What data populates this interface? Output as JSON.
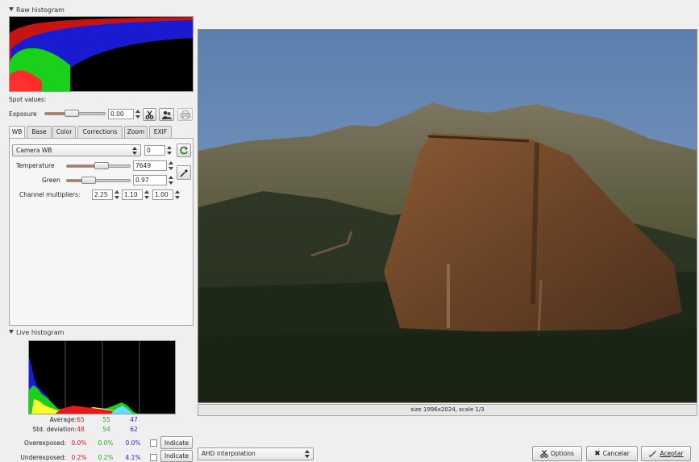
{
  "raw_histogram": {
    "title": "Raw histogram"
  },
  "spot_values": {
    "label": "Spot values:"
  },
  "exposure": {
    "label": "Exposure",
    "value": "0.00",
    "level": 0.45
  },
  "tabs": [
    {
      "label": "WB",
      "active": true
    },
    {
      "label": "Base"
    },
    {
      "label": "Color"
    },
    {
      "label": "Corrections"
    },
    {
      "label": "Zoom"
    },
    {
      "label": "EXIF"
    }
  ],
  "wb": {
    "preset": "Camera WB",
    "preset_value": "0",
    "temperature": {
      "label": "Temperature",
      "value": "7649",
      "level": 0.55
    },
    "green": {
      "label": "Green",
      "value": "0.97",
      "level": 0.35
    },
    "channel_multipliers": {
      "label": "Channel multipliers:",
      "values": [
        "2.25",
        "1.10",
        "1.00"
      ]
    }
  },
  "live_histogram": {
    "title": "Live histogram",
    "average": {
      "label": "Average:",
      "r": "65",
      "g": "55",
      "b": "47"
    },
    "std_deviation": {
      "label": "Std. deviation:",
      "r": "48",
      "g": "54",
      "b": "62"
    },
    "overexposed": {
      "label": "Overexposed:",
      "r": "0.0%",
      "g": "0.0%",
      "b": "0.0%",
      "button": "Indicate"
    },
    "underexposed": {
      "label": "Underexposed:",
      "r": "0.2%",
      "g": "0.2%",
      "b": "4.1%",
      "button": "Indicate"
    }
  },
  "preview": {
    "status": "size 1996x2024, scale 1/3"
  },
  "interpolation": {
    "selected": "AHD interpolation"
  },
  "buttons": {
    "options": "Options",
    "cancel": "Cancelar",
    "accept": "Aceptar"
  },
  "colors": {
    "accent": "#b87a52",
    "red": "#d41c1c",
    "green": "#27a827",
    "blue": "#2a2ad8"
  },
  "icons": [
    "scissors-icon",
    "people-icon",
    "printer-icon",
    "eyedropper-icon",
    "refresh-icon",
    "options-icon",
    "cancel-x-icon",
    "accept-icon"
  ]
}
